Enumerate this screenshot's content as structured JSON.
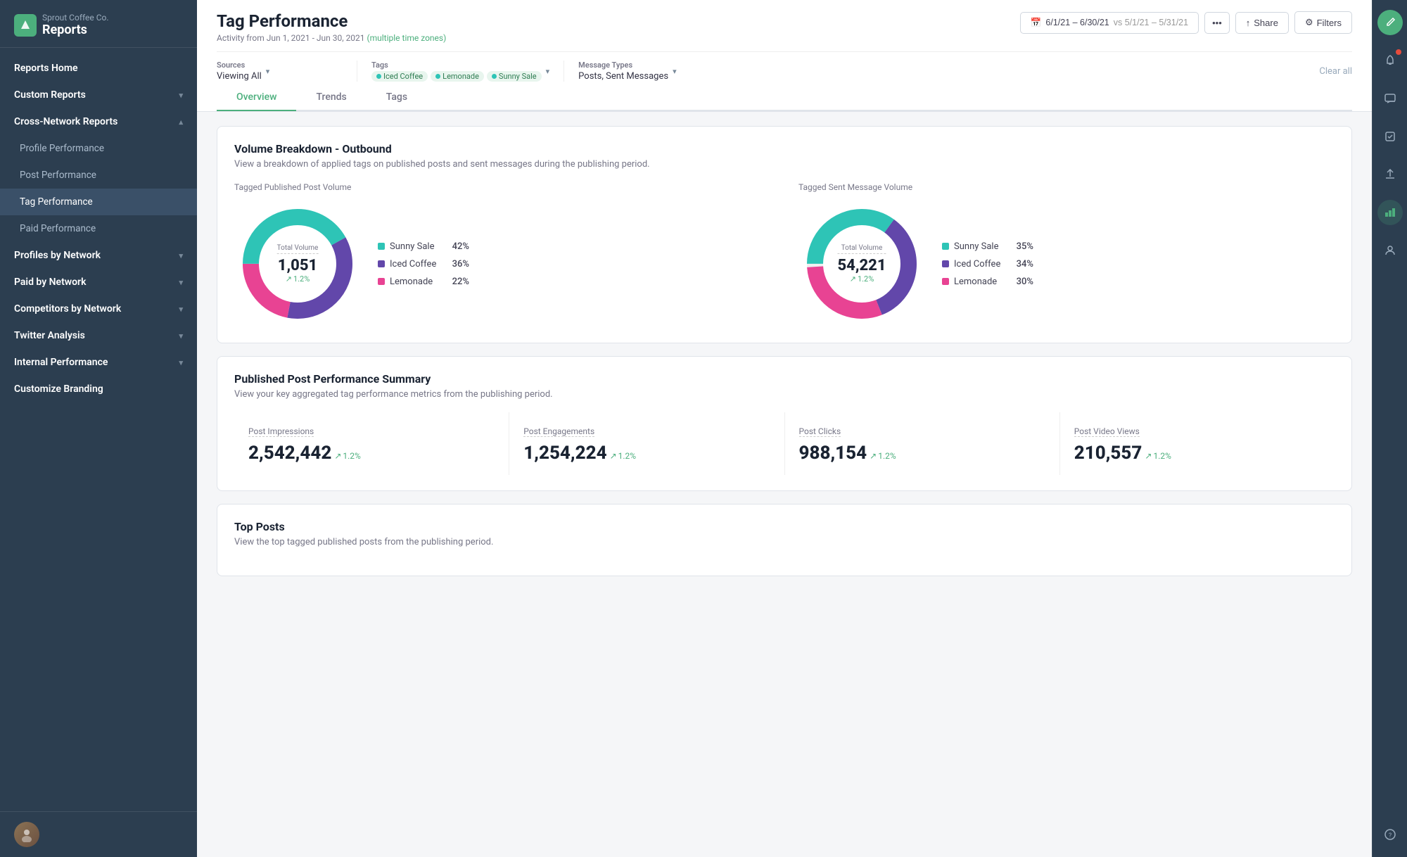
{
  "brand": {
    "company": "Sprout Coffee Co.",
    "app": "Reports"
  },
  "sidebar": {
    "top_nav": [
      {
        "id": "reports-home",
        "label": "Reports Home",
        "type": "top",
        "active": false
      },
      {
        "id": "custom-reports",
        "label": "Custom Reports",
        "type": "top",
        "chevron": true,
        "active": false
      },
      {
        "id": "cross-network",
        "label": "Cross-Network Reports",
        "type": "top",
        "chevron": true,
        "expanded": true,
        "active": false
      }
    ],
    "sub_nav": [
      {
        "id": "profile-performance",
        "label": "Profile Performance",
        "active": false
      },
      {
        "id": "post-performance",
        "label": "Post Performance",
        "active": false
      },
      {
        "id": "tag-performance",
        "label": "Tag Performance",
        "active": true
      },
      {
        "id": "paid-performance",
        "label": "Paid Performance",
        "active": false
      }
    ],
    "section_nav": [
      {
        "id": "profiles-by-network",
        "label": "Profiles by Network",
        "chevron": true
      },
      {
        "id": "paid-by-network",
        "label": "Paid by Network",
        "chevron": true
      },
      {
        "id": "competitors-by-network",
        "label": "Competitors by Network",
        "chevron": true
      },
      {
        "id": "twitter-analysis",
        "label": "Twitter Analysis",
        "chevron": true
      },
      {
        "id": "internal-performance",
        "label": "Internal Performance",
        "chevron": true
      }
    ],
    "bottom_nav": [
      {
        "id": "customize-branding",
        "label": "Customize Branding"
      }
    ]
  },
  "header": {
    "title": "Tag Performance",
    "subtitle": "Activity from Jun 1, 2021 - Jun 30, 2021",
    "date_highlight": "(multiple time zones)",
    "date_range": "6/1/21 – 6/30/21",
    "vs_range": "vs 5/1/21 – 5/31/21",
    "more_label": "•••",
    "share_label": "Share",
    "filters_label": "Filters"
  },
  "filter_bar": {
    "sources_label": "Sources",
    "sources_value": "Viewing All",
    "tags_label": "Tags",
    "tags": [
      {
        "name": "Iced Coffee",
        "color": "#4caf7d"
      },
      {
        "name": "Lemonade",
        "color": "#4caf7d"
      },
      {
        "name": "Sunny Sale",
        "color": "#4caf7d"
      }
    ],
    "message_types_label": "Message Types",
    "message_types_value": "Posts, Sent Messages",
    "clear_all": "Clear all"
  },
  "tabs": [
    {
      "id": "overview",
      "label": "Overview",
      "active": true
    },
    {
      "id": "trends",
      "label": "Trends",
      "active": false
    },
    {
      "id": "tags",
      "label": "Tags",
      "active": false
    }
  ],
  "volume_breakdown": {
    "title": "Volume Breakdown - Outbound",
    "desc": "View a breakdown of applied tags on published posts and sent messages during the publishing period.",
    "published_label": "Tagged Published Post Volume",
    "sent_label": "Tagged Sent Message Volume",
    "published_chart": {
      "center_label": "Total Volume",
      "center_value": "1,051",
      "change": "1.2%",
      "segments": [
        {
          "label": "Sunny Sale",
          "pct": 42,
          "color": "#2ec4b6",
          "degrees": 151
        },
        {
          "label": "Iced Coffee",
          "pct": 36,
          "color": "#6247aa",
          "degrees": 130
        },
        {
          "label": "Lemonade",
          "pct": 22,
          "color": "#e84393",
          "degrees": 79
        }
      ]
    },
    "sent_chart": {
      "center_label": "Total Volume",
      "center_value": "54,221",
      "change": "1.2%",
      "segments": [
        {
          "label": "Sunny Sale",
          "pct": 35,
          "color": "#2ec4b6",
          "degrees": 126
        },
        {
          "label": "Iced Coffee",
          "pct": 34,
          "color": "#6247aa",
          "degrees": 122
        },
        {
          "label": "Lemonade",
          "pct": 30,
          "color": "#e84393",
          "degrees": 108
        }
      ]
    }
  },
  "published_summary": {
    "title": "Published Post Performance Summary",
    "desc": "View your key aggregated tag performance metrics from the publishing period.",
    "metrics": [
      {
        "id": "post-impressions",
        "name": "Post Impressions",
        "value": "2,542,442",
        "change": "1.2%"
      },
      {
        "id": "post-engagements",
        "name": "Post Engagements",
        "value": "1,254,224",
        "change": "1.2%"
      },
      {
        "id": "post-clicks",
        "name": "Post Clicks",
        "value": "988,154",
        "change": "1.2%"
      },
      {
        "id": "post-video-views",
        "name": "Post Video Views",
        "value": "210,557",
        "change": "1.2%"
      }
    ]
  },
  "top_posts": {
    "title": "Top Posts",
    "desc": "View the top tagged published posts from the publishing period."
  },
  "colors": {
    "green": "#4caf7d",
    "sidebar_bg": "#2c3e50",
    "teal": "#2ec4b6",
    "purple": "#6247aa",
    "pink": "#e84393"
  }
}
